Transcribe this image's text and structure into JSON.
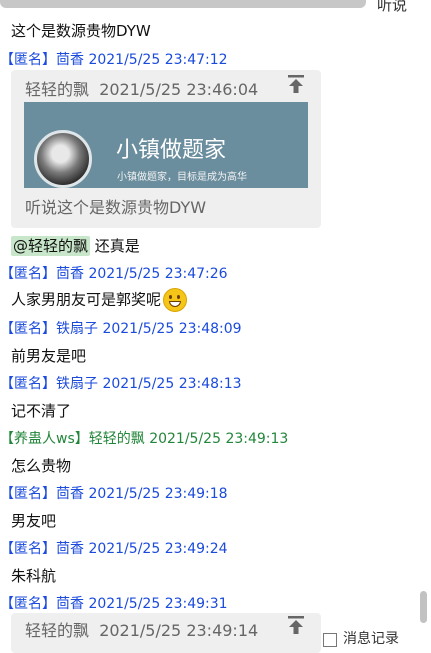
{
  "top": {
    "partial_text": "听说"
  },
  "messages": [
    {
      "text": "这个是数源贵物DYW"
    }
  ],
  "entries": [
    {
      "tag": "【匿名】",
      "name": "茴香",
      "time": "2021/5/25 23:47:12"
    },
    {
      "tag": "【匿名】",
      "name": "茴香",
      "time": "2021/5/25 23:47:26"
    },
    {
      "tag": "【匿名】",
      "name": "铁扇子",
      "time": "2021/5/25 23:48:09"
    },
    {
      "tag": "【匿名】",
      "name": "铁扇子",
      "time": "2021/5/25 23:48:13"
    },
    {
      "tag": "【养蛊人ws】",
      "name": "轻轻的飘",
      "time": "2021/5/25 23:49:13"
    },
    {
      "tag": "【匿名】",
      "name": "茴香",
      "time": "2021/5/25 23:49:18"
    },
    {
      "tag": "【匿名】",
      "name": "茴香",
      "time": "2021/5/25 23:49:24"
    },
    {
      "tag": "【匿名】",
      "name": "茴香",
      "time": "2021/5/25 23:49:31"
    }
  ],
  "quote1": {
    "author": "轻轻的飘",
    "time": "2021/5/25 23:46:04",
    "card_title": "小镇做题家",
    "card_subtitle": "小镇做题家，目标是成为高华",
    "text": "听说这个是数源贵物DYW"
  },
  "reply1": {
    "mention": "@轻轻的飘",
    "text": " 还真是"
  },
  "msg2": {
    "text": "人家男朋友可是郭奖呢"
  },
  "msg3": {
    "text": "前男友是吧"
  },
  "msg4": {
    "text": "记不清了"
  },
  "msg5": {
    "text": "怎么贵物"
  },
  "msg6": {
    "text": "男友吧"
  },
  "msg7": {
    "text": "朱科航"
  },
  "quote2": {
    "author": "轻轻的飘",
    "time": "2021/5/25 23:49:14"
  },
  "footer": {
    "checkbox_label": "消息记录"
  }
}
